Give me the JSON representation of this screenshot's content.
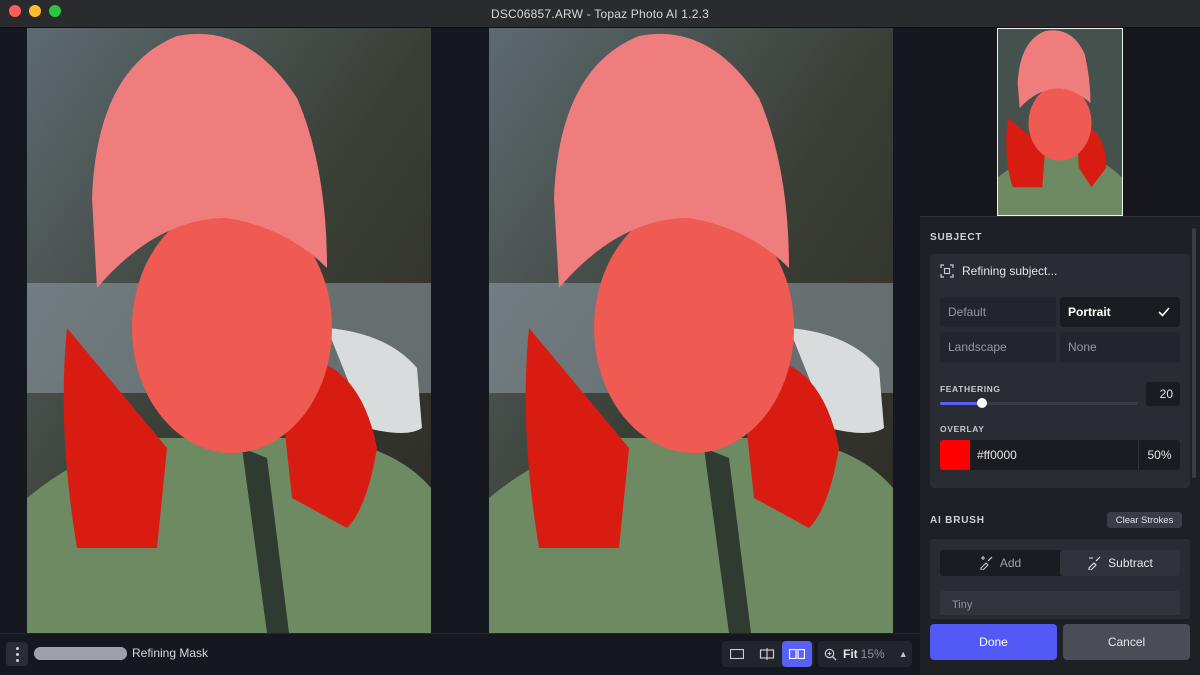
{
  "window": {
    "title": "DSC06857.ARW - Topaz Photo AI 1.2.3"
  },
  "status": {
    "progress_label": "Refining Mask",
    "progress": 1.0
  },
  "zoom": {
    "mode": "Fit",
    "percent": "15%"
  },
  "view_modes": [
    "single-view",
    "split-view",
    "side-by-side"
  ],
  "view_active": "side-by-side",
  "subject": {
    "section_title": "SUBJECT",
    "status_text": "Refining subject...",
    "options": [
      "Default",
      "Portrait",
      "Landscape",
      "None"
    ],
    "selected": "Portrait",
    "feathering_label": "FEATHERING",
    "feathering_value": "20",
    "feathering_level": 0.21,
    "overlay_label": "OVERLAY",
    "overlay_hex": "#ff0000",
    "overlay_opacity": "50%",
    "overlay_color": "#ff0000"
  },
  "ai_brush": {
    "section_title": "AI BRUSH",
    "clear_label": "Clear Strokes",
    "add_label": "Add",
    "subtract_label": "Subtract",
    "active": "Subtract",
    "size_label": "Tiny"
  },
  "footer": {
    "done_label": "Done",
    "cancel_label": "Cancel"
  },
  "colors": {
    "accent": "#5960f6",
    "panel_bg": "#1e2026"
  }
}
